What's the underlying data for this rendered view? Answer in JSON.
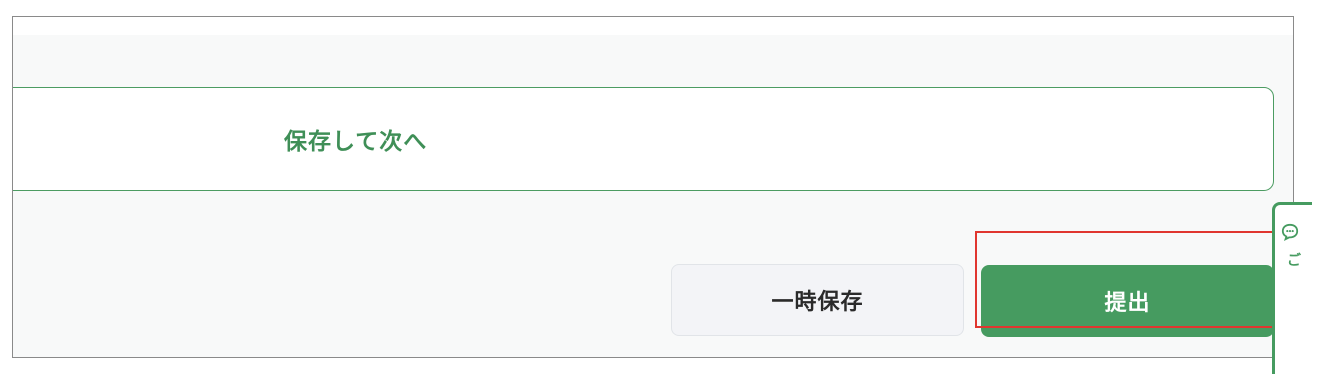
{
  "buttons": {
    "save_next": "保存して次へ",
    "temp_save": "一時保存",
    "submit": "提出"
  },
  "side_tab": {
    "icon": "chat-bubble-icon",
    "label": "ご"
  },
  "colors": {
    "accent_green": "#469b60",
    "highlight_red": "#e0362f",
    "panel_bg": "#f8f9f9"
  }
}
